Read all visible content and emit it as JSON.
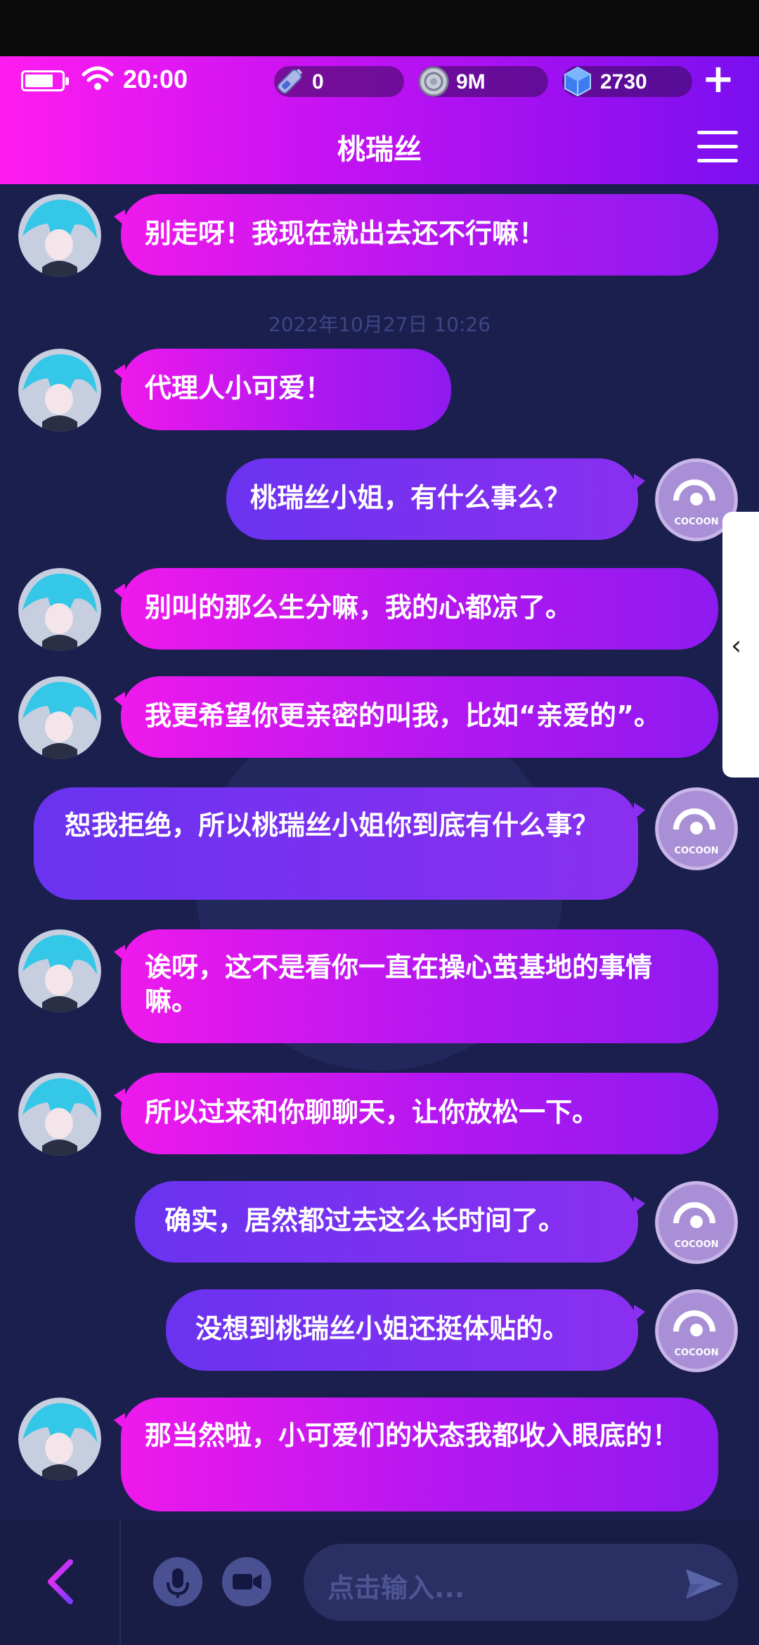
{
  "status_bar": {
    "time": "20:00"
  },
  "currencies": [
    {
      "icon": "energy-battery-icon",
      "value": "0"
    },
    {
      "icon": "coin-icon",
      "value": "9M"
    },
    {
      "icon": "crystal-cube-icon",
      "value": "2730"
    }
  ],
  "header": {
    "title": "桃瑞丝"
  },
  "chat": {
    "timestamp": "2022年10月27日 10:26",
    "messages": [
      {
        "sender": "contact",
        "text": "别走呀！我现在就出去还不行嘛！"
      },
      {
        "sender": "contact",
        "text": "代理人小可爱！"
      },
      {
        "sender": "me",
        "text": "桃瑞丝小姐，有什么事么？"
      },
      {
        "sender": "contact",
        "text": "别叫的那么生分嘛，我的心都凉了。"
      },
      {
        "sender": "contact",
        "text": "我更希望你更亲密的叫我，比如“亲爱的”。"
      },
      {
        "sender": "me",
        "text": "恕我拒绝，所以桃瑞丝小姐你到底有什么事？"
      },
      {
        "sender": "contact",
        "text": "诶呀，这不是看你一直在操心茧基地的事情嘛。"
      },
      {
        "sender": "contact",
        "text": "所以过来和你聊聊天，让你放松一下。"
      },
      {
        "sender": "me",
        "text": "确实，居然都过去这么长时间了。"
      },
      {
        "sender": "me",
        "text": "没想到桃瑞丝小姐还挺体贴的。"
      },
      {
        "sender": "contact",
        "text": "那当然啦，小可爱们的状态我都收入眼底的！"
      }
    ],
    "my_avatar_label": "COCOON"
  },
  "input": {
    "placeholder": "点击输入..."
  },
  "colors": {
    "header_start": "#ff1cf0",
    "header_end": "#7a0ff0",
    "background": "#1a1d4a",
    "bubble_out": "#6a33f0"
  }
}
